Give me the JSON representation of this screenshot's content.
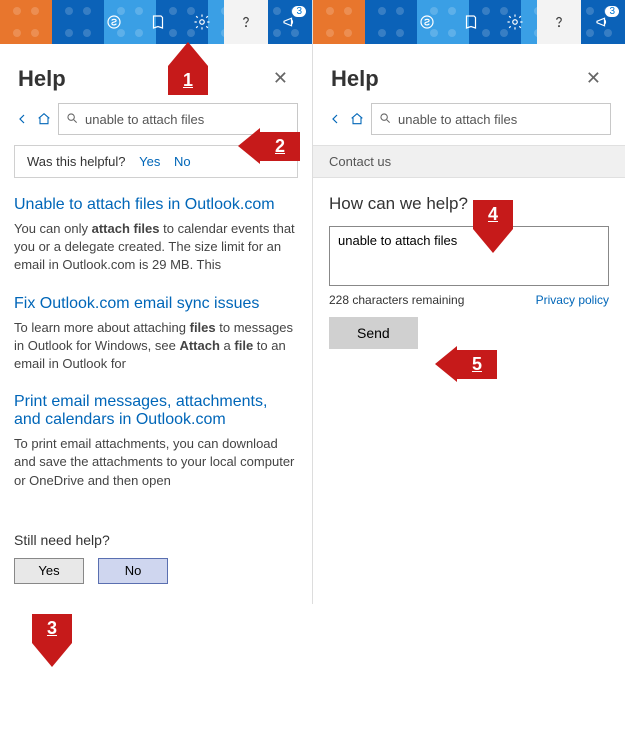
{
  "left": {
    "title": "Help",
    "search": "unable to attach files",
    "helpful": {
      "q": "Was this helpful?",
      "yes": "Yes",
      "no": "No"
    },
    "articles": [
      {
        "title": "Unable to attach files in Outlook.com",
        "body": "You can only <b>attach files</b> to calendar events that you or a delegate created. The size limit for an email in Outlook.com is 29 MB. This"
      },
      {
        "title": "Fix Outlook.com email sync issues",
        "body": "To learn more about attaching <b>files</b> to messages in Outlook for Windows, see <b>Attach</b> a <b>file</b> to an email in Outlook for"
      },
      {
        "title": "Print email messages, attachments, and calendars in Outlook.com",
        "body": "To print email attachments, you can download and save the attachments to your local computer or OneDrive and then open"
      }
    ],
    "still": {
      "q": "Still need help?",
      "yes": "Yes",
      "no": "No"
    }
  },
  "right": {
    "title": "Help",
    "search": "unable to attach files",
    "contact": "Contact us",
    "how": "How can we help?",
    "msg": "unable to attach files",
    "remaining": "228 characters remaining",
    "privacy": "Privacy policy",
    "send": "Send"
  },
  "badge": "3",
  "annotations": {
    "a1": "1",
    "a2": "2",
    "a3": "3",
    "a4": "4",
    "a5": "5"
  }
}
